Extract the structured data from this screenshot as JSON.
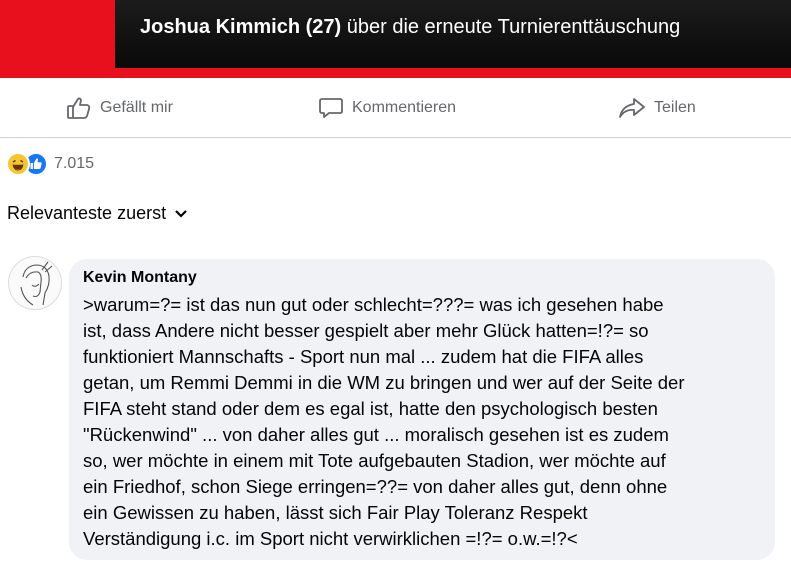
{
  "banner": {
    "quote_mark": "”",
    "caption_name": "Joshua Kimmich (27)",
    "caption_rest": " über die erneute Turnierenttäuschung"
  },
  "actions": {
    "like": {
      "label": "Gefällt mir",
      "icon": "thumbs-up-icon"
    },
    "comment": {
      "label": "Kommentieren",
      "icon": "comment-icon"
    },
    "share": {
      "label": "Teilen",
      "icon": "share-icon"
    }
  },
  "reactions": {
    "icons": [
      "laugh-reaction-icon",
      "like-reaction-icon"
    ],
    "count": "7.015"
  },
  "sort": {
    "label": "Relevanteste zuerst",
    "icon": "chevron-down-icon"
  },
  "comments": [
    {
      "author": "Kevin Montany",
      "text": ">warum=?= ist das nun gut oder schlecht=???= was ich gesehen habe\nist, dass Andere nicht besser gespielt aber mehr Glück hatten=!?= so\nfunktioniert Mannschafts - Sport nun mal ... zudem hat die FIFA alles\ngetan, um Remmi Demmi in die WM zu bringen und wer auf der Seite der\nFIFA steht stand oder dem es egal ist, hatte den psychologisch  besten\n\"Rückenwind\"  ... von daher alles gut ... moralisch gesehen ist es zudem\nso, wer möchte in einem mit Tote aufgebauten Stadion, wer möchte auf\nein Friedhof, schon Siege erringen=??= von daher alles gut, denn ohne\nein Gewissen zu haben, lässt sich Fair Play Toleranz Respekt\nVerständigung i.c. im Sport nicht verwirklichen =!?= o.w.=!?<"
    }
  ],
  "colors": {
    "banner_red": "#e8101c",
    "facebook_blue": "#1877f2",
    "secondary_text": "#65676b",
    "bubble_bg": "#f0f2f5"
  }
}
